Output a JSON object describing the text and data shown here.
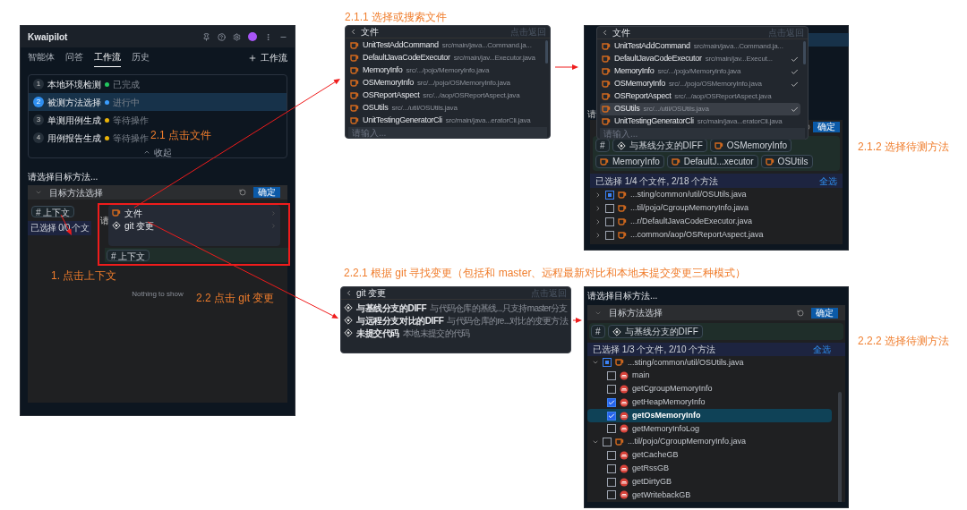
{
  "main_panel": {
    "title": "Kwaipilot",
    "tabs": [
      {
        "label": "智能体",
        "selected": false
      },
      {
        "label": "问答",
        "selected": false
      },
      {
        "label": "工作流",
        "selected": true
      },
      {
        "label": "历史",
        "selected": false
      }
    ],
    "new_button": "工作流",
    "steps": [
      {
        "number": "1",
        "name": "本地环境检测",
        "status": "已完成",
        "color": "#22c55e",
        "selected": false
      },
      {
        "number": "2",
        "name": "被测方法选择",
        "status": "进行中",
        "color": "#3b9eff",
        "selected": true
      },
      {
        "number": "3",
        "name": "单测用例生成",
        "status": "等待操作",
        "color": "#eab308",
        "selected": false
      },
      {
        "number": "4",
        "name": "用例报告生成",
        "status": "等待操作",
        "color": "#eab308",
        "selected": false
      }
    ],
    "collapse": "收起",
    "prompt": "请选择目标方法...",
    "section_title": "目标方法选择",
    "confirm": "确定",
    "context_tag": "# 上下文",
    "summary": "已选择 0/0 个文",
    "empty": "Nothing to show",
    "popup": {
      "behind": "请",
      "items": [
        {
          "kind": "file",
          "label": "文件"
        },
        {
          "kind": "git",
          "label": "git 变更"
        }
      ],
      "context_tag": "# 上下文"
    }
  },
  "annotations": [
    {
      "text": "2.1 点击文件"
    },
    {
      "text": "1. 点击上下文"
    },
    {
      "text": "2.2 点击 git 变更"
    },
    {
      "text": "2.1.1 选择或搜索文件"
    },
    {
      "text": "2.1.2 选择待测方法"
    },
    {
      "text": "2.2.1 根据 git 寻找变更（包括和 master、远程最新对比和本地未提交变更三种模式）"
    },
    {
      "text": "2.2.2 选择待测方法"
    }
  ],
  "file_picker": {
    "title": "文件",
    "hint": "点击返回",
    "placeholder": "请输入...",
    "files": [
      {
        "name": "UnitTestAddCommand",
        "path": "src/main/java...Command.ja..."
      },
      {
        "name": "DefaultJavaCodeExecutor",
        "path": "src/main/jav...Executor.java"
      },
      {
        "name": "MemoryInfo",
        "path": "src/.../pojo/MemoryInfo.java"
      },
      {
        "name": "OSMemoryInfo",
        "path": "src/.../pojo/OSMemoryInfo.java"
      },
      {
        "name": "OSReportAspect",
        "path": "src/.../aop/OSReportAspect.java"
      },
      {
        "name": "OSUtils",
        "path": "src/.../util/OSUtils.java"
      },
      {
        "name": "UnitTestingGeneratorCli",
        "path": "src/main/java...eratorCli.java"
      }
    ]
  },
  "file_selection": {
    "behind": "请",
    "confirm": "确定",
    "title": "文件",
    "hint": "点击返回",
    "placeholder": "请输入...",
    "files": [
      {
        "name": "UnitTestAddCommand",
        "path": "src/main/java...Command.ja...",
        "checked": false,
        "selected": false
      },
      {
        "name": "DefaultJavaCodeExecutor",
        "path": "src/main/jav...Execut...",
        "checked": true,
        "selected": false
      },
      {
        "name": "MemoryInfo",
        "path": "src/.../pojo/MemoryInfo.java",
        "checked": true,
        "selected": false
      },
      {
        "name": "OSMemoryInfo",
        "path": "src/.../pojo/OSMemoryInfo.java",
        "checked": true,
        "selected": false
      },
      {
        "name": "OSReportAspect",
        "path": "src/.../aop/OSReportAspect.java",
        "checked": false,
        "selected": false
      },
      {
        "name": "OSUtils",
        "path": "src/.../util/OSUtils.java",
        "checked": true,
        "selected": true
      },
      {
        "name": "UnitTestingGeneratorCli",
        "path": "src/main/java...eratorCli.java",
        "checked": false,
        "selected": false
      }
    ],
    "tags": [
      {
        "kind": "hash",
        "label": "#"
      },
      {
        "kind": "git",
        "label": "与基线分支的DIFF"
      },
      {
        "kind": "file",
        "label": "OSMemoryInfo"
      },
      {
        "kind": "file",
        "label": "MemoryInfo"
      },
      {
        "kind": "file",
        "label": "DefaultJ...xecutor"
      },
      {
        "kind": "file",
        "label": "OSUtils"
      }
    ],
    "summary": "已选择 1/4 个文件, 2/18 个方法",
    "select_all": "全选",
    "tree": [
      {
        "path": "...sting/common/util/OSUtils.java",
        "partial": true
      },
      {
        "path": "...til/pojo/CgroupMemoryInfo.java",
        "partial": false
      },
      {
        "path": "...r/DefaultJavaCodeExecutor.java",
        "partial": false
      },
      {
        "path": "...common/aop/OSReportAspect.java",
        "partial": false
      }
    ]
  },
  "git_picker": {
    "title": "git 变更",
    "hint": "点击返回",
    "options": [
      {
        "name": "与基线分支的DIFF",
        "description": "与代码仓库的基线...只支持master分支"
      },
      {
        "name": "与远程分支对比的DIFF",
        "description": "与代码仓库的re...对比的变更方法"
      },
      {
        "name": "未提交代码",
        "description": "本地未提交的代码"
      }
    ]
  },
  "method_panel": {
    "prompt": "请选择目标方法...",
    "section_title": "目标方法选择",
    "confirm": "确定",
    "tags": [
      {
        "kind": "hash",
        "label": "#"
      },
      {
        "kind": "git",
        "label": "与基线分支的DIFF"
      }
    ],
    "summary": "已选择 1/3 个文件, 2/10 个方法",
    "select_all": "全选",
    "tree": [
      {
        "path": "...sting/common/util/OSUtils.java",
        "expanded": true,
        "partial": true,
        "methods": [
          {
            "name": "main",
            "checked": false,
            "selected": false
          },
          {
            "name": "getCgroupMemoryInfo",
            "checked": false,
            "selected": false
          },
          {
            "name": "getHeapMemoryInfo",
            "checked": true,
            "selected": false
          },
          {
            "name": "getOsMemoryInfo",
            "checked": true,
            "selected": true
          },
          {
            "name": "getMemoryInfoLog",
            "checked": false,
            "selected": false
          }
        ]
      },
      {
        "path": "...til/pojo/CgroupMemoryInfo.java",
        "expanded": true,
        "partial": false,
        "methods": [
          {
            "name": "getCacheGB",
            "checked": false,
            "selected": false
          },
          {
            "name": "getRssGB",
            "checked": false,
            "selected": false
          },
          {
            "name": "getDirtyGB",
            "checked": false,
            "selected": false
          },
          {
            "name": "getWritebackGB",
            "checked": false,
            "selected": false
          }
        ]
      }
    ]
  }
}
